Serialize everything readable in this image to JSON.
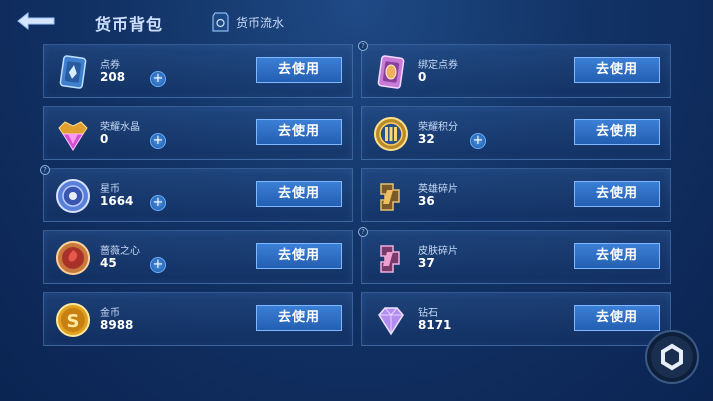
{
  "header": {
    "title": "货币背包",
    "flow_label": "货币流水"
  },
  "use_label": "去使用",
  "currencies": [
    {
      "name": "点券",
      "amount": "208",
      "icon": "coupon-card-icon",
      "plus": true,
      "help": false
    },
    {
      "name": "绑定点券",
      "amount": "0",
      "icon": "bound-coupon-card-icon",
      "plus": false,
      "help": true
    },
    {
      "name": "荣耀水晶",
      "amount": "0",
      "icon": "glory-crystal-icon",
      "plus": true,
      "help": false
    },
    {
      "name": "荣耀积分",
      "amount": "32",
      "icon": "glory-points-icon",
      "plus": true,
      "help": false
    },
    {
      "name": "星币",
      "amount": "1664",
      "icon": "star-coin-icon",
      "plus": true,
      "help": true
    },
    {
      "name": "英雄碎片",
      "amount": "36",
      "icon": "hero-fragment-icon",
      "plus": false,
      "help": false
    },
    {
      "name": "蔷薇之心",
      "amount": "45",
      "icon": "rose-heart-icon",
      "plus": true,
      "help": false
    },
    {
      "name": "皮肤碎片",
      "amount": "37",
      "icon": "skin-fragment-icon",
      "plus": false,
      "help": true
    },
    {
      "name": "金币",
      "amount": "8988",
      "icon": "gold-coin-icon",
      "plus": false,
      "help": false
    },
    {
      "name": "钻石",
      "amount": "8171",
      "icon": "diamond-icon",
      "plus": false,
      "help": false
    }
  ],
  "colors": {
    "accent": "#2f6fc8",
    "background": "#123366",
    "text": "#ffffff"
  }
}
